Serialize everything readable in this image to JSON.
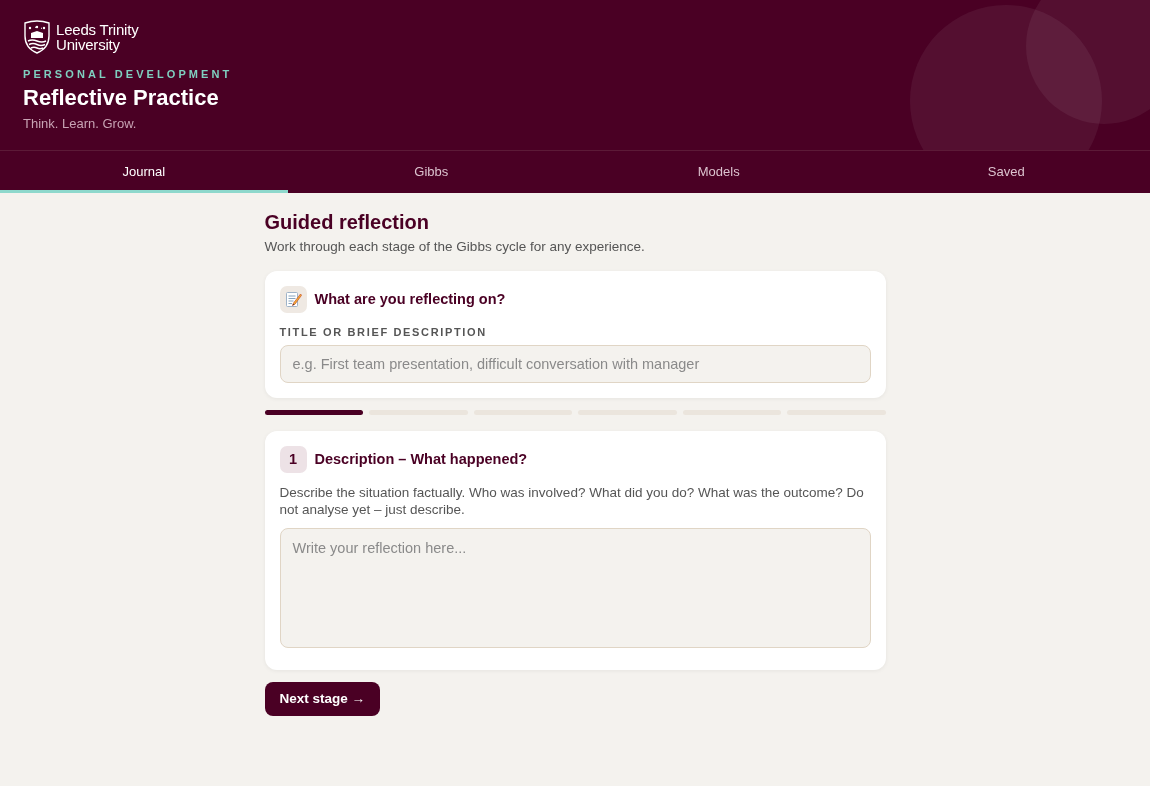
{
  "header": {
    "logo": {
      "lines": [
        "Leeds Trinity",
        "University"
      ]
    },
    "eyebrow": "PERSONAL DEVELOPMENT",
    "title": "Reflective Practice",
    "tagline": "Think. Learn. Grow."
  },
  "tabs": [
    {
      "label": "Journal",
      "selected": true
    },
    {
      "label": "Gibbs",
      "selected": false
    },
    {
      "label": "Models",
      "selected": false
    },
    {
      "label": "Saved",
      "selected": false
    }
  ],
  "page": {
    "heading": "Guided reflection",
    "subheading": "Work through each stage of the Gibbs cycle for any experience."
  },
  "topic_card": {
    "title": "What are you reflecting on?",
    "field_label": "TITLE OR BRIEF DESCRIPTION",
    "field": {
      "placeholder": "e.g. First team presentation, difficult conversation with manager"
    }
  },
  "progress": [
    {
      "completed": true
    },
    {
      "completed": false
    },
    {
      "completed": false
    },
    {
      "completed": false
    },
    {
      "completed": false
    },
    {
      "completed": false
    }
  ],
  "stage_card": {
    "number": "1",
    "title": "Description – What happened?",
    "prompt": "Describe the situation factually. Who was involved? What did you do? What was the outcome? Do not analyse yet – just describe.",
    "answer": {
      "placeholder": "Write your reflection here..."
    }
  },
  "buttons": [
    {
      "label": "Next stage →"
    }
  ]
}
